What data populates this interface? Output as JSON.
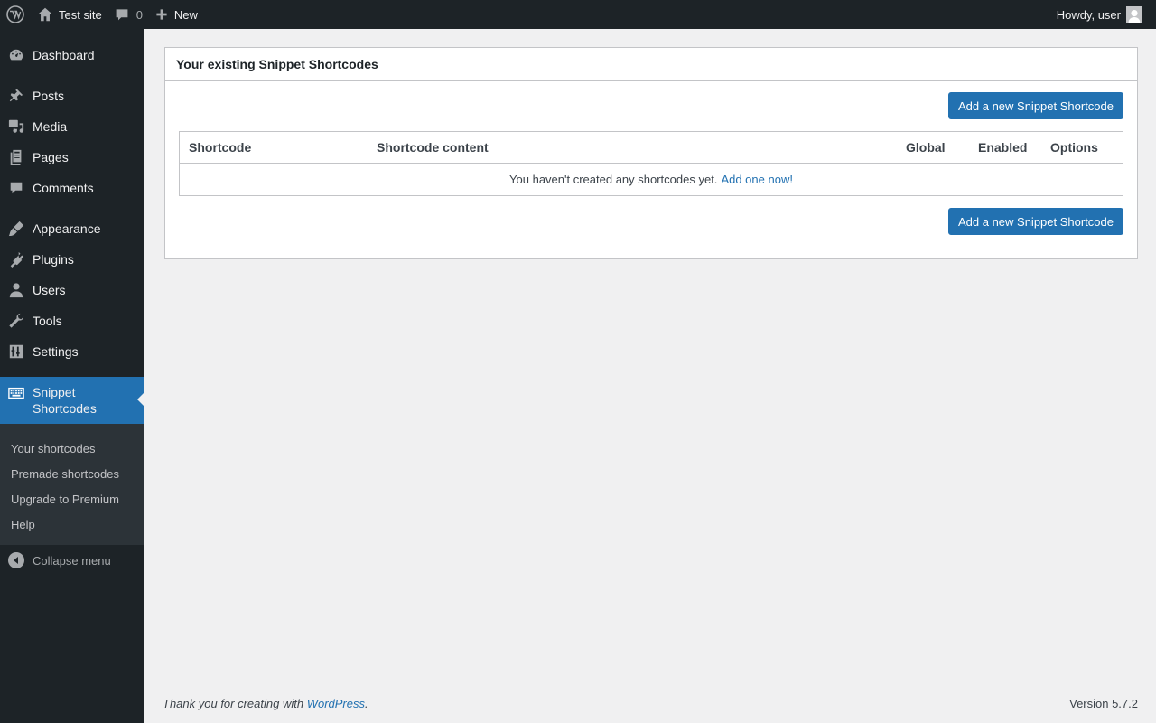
{
  "adminbar": {
    "site_name": "Test site",
    "comments_count": "0",
    "new_label": "New",
    "howdy": "Howdy, user"
  },
  "sidebar": {
    "items": [
      {
        "label": "Dashboard",
        "icon": "dashboard-icon"
      },
      {
        "label": "Posts",
        "icon": "pin-icon"
      },
      {
        "label": "Media",
        "icon": "media-icon"
      },
      {
        "label": "Pages",
        "icon": "pages-icon"
      },
      {
        "label": "Comments",
        "icon": "comment-icon"
      },
      {
        "label": "Appearance",
        "icon": "brush-icon"
      },
      {
        "label": "Plugins",
        "icon": "plug-icon"
      },
      {
        "label": "Users",
        "icon": "user-icon"
      },
      {
        "label": "Tools",
        "icon": "wrench-icon"
      },
      {
        "label": "Settings",
        "icon": "settings-icon"
      }
    ],
    "current": {
      "label_line1": "Snippet",
      "label_line2": "Shortcodes",
      "icon": "keyboard-icon"
    },
    "submenu": [
      "Your shortcodes",
      "Premade shortcodes",
      "Upgrade to Premium",
      "Help"
    ],
    "collapse": "Collapse menu"
  },
  "panel": {
    "title": "Your existing Snippet Shortcodes",
    "add_button": "Add a new Snippet Shortcode",
    "columns": [
      "Shortcode",
      "Shortcode content",
      "Global",
      "Enabled",
      "Options"
    ],
    "empty_text": "You haven't created any shortcodes yet.",
    "empty_link": "Add one now!"
  },
  "footer": {
    "thanks": "Thank you for creating with",
    "wp_link": "WordPress",
    "period": ".",
    "version": "Version 5.7.2"
  },
  "colors": {
    "accent": "#2271b1",
    "sidebar_bg": "#1d2327",
    "page_bg": "#f0f0f1"
  }
}
